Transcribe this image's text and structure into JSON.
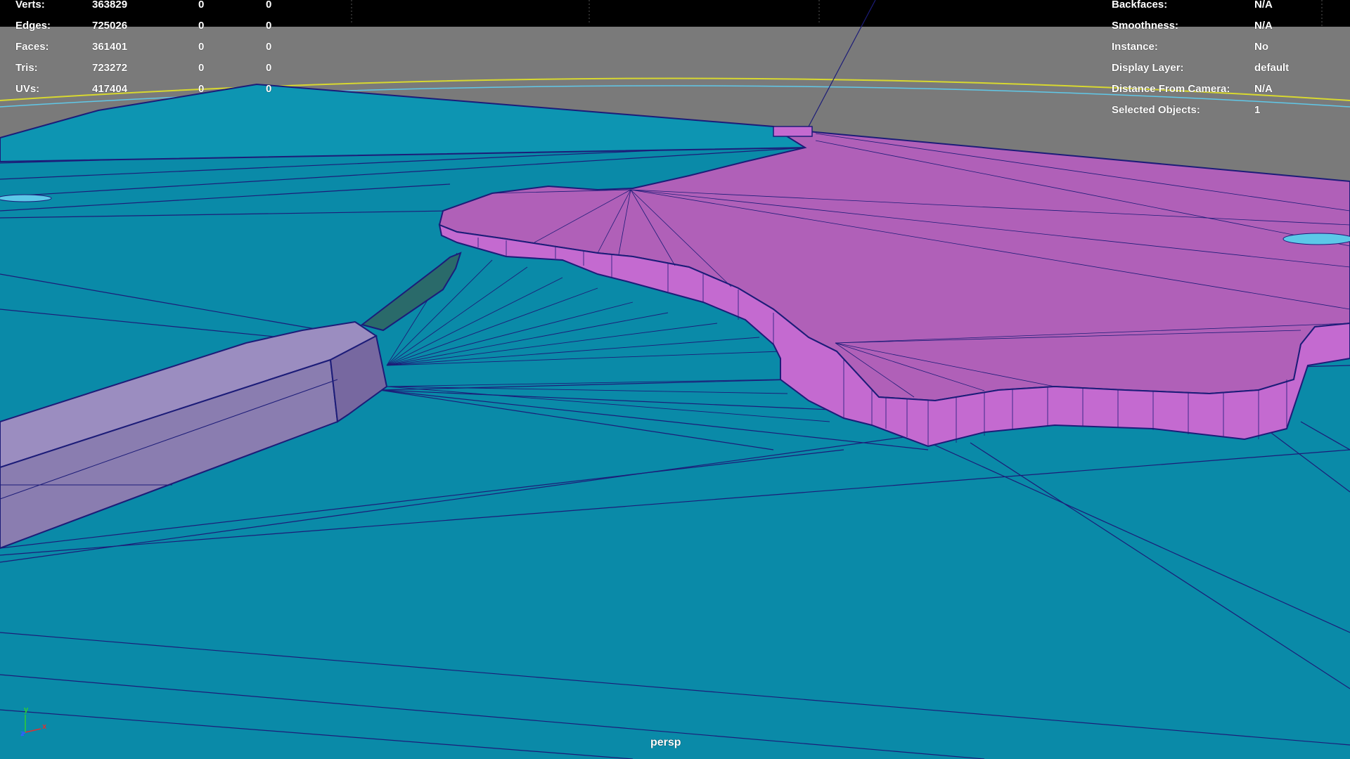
{
  "viewport": {
    "camera": "persp",
    "colors": {
      "ground": "#0a8aa8",
      "background_top": "#7a7a7a",
      "hud_bar": "#000000",
      "selected_mesh": "#b060b8",
      "selected_mesh_side": "#c46ad0",
      "bridge_mesh": "#8a7db0",
      "wireframe": "#1c1c78",
      "horizon_yellow": "#d8d830",
      "horizon_cyan": "#60c8e8"
    }
  },
  "hud_left": {
    "rows": [
      {
        "label": "Verts:",
        "value": "363829",
        "col2": "0",
        "col3": "0"
      },
      {
        "label": "Edges:",
        "value": "725026",
        "col2": "0",
        "col3": "0"
      },
      {
        "label": "Faces:",
        "value": "361401",
        "col2": "0",
        "col3": "0"
      },
      {
        "label": "Tris:",
        "value": "723272",
        "col2": "0",
        "col3": "0"
      },
      {
        "label": "UVs:",
        "value": "417404",
        "col2": "0",
        "col3": "0"
      }
    ]
  },
  "hud_right": {
    "rows": [
      {
        "label": "Backfaces:",
        "value": "N/A"
      },
      {
        "label": "Smoothness:",
        "value": "N/A"
      },
      {
        "label": "Instance:",
        "value": "No"
      },
      {
        "label": "Display Layer:",
        "value": "default"
      },
      {
        "label": "Distance From Camera:",
        "value": "N/A"
      },
      {
        "label": "Selected Objects:",
        "value": "1"
      }
    ]
  },
  "axis_gizmo": {
    "y": "y",
    "z": "z",
    "x": "x",
    "colors": {
      "y": "#30d030",
      "z": "#3060ff",
      "x": "#e03030"
    }
  }
}
